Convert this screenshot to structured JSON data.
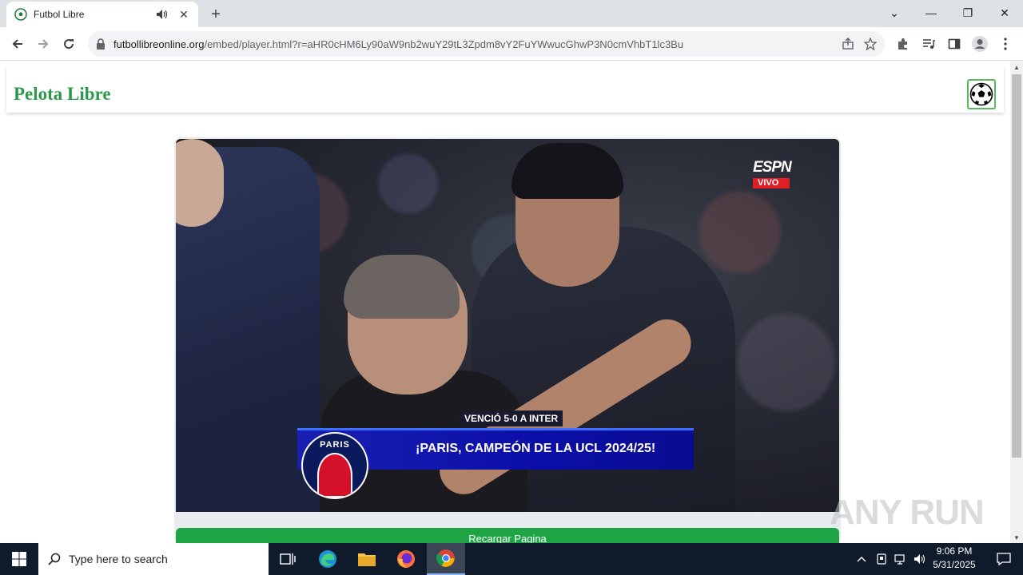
{
  "browser": {
    "tab": {
      "title": "Futbol Libre",
      "close_glyph": "✕"
    },
    "newtab_glyph": "+",
    "window_controls": {
      "tab_search_glyph": "⌄",
      "minimize_glyph": "—",
      "restore_glyph": "❐",
      "close_glyph": "✕"
    },
    "url": {
      "host": "futbollibreonline.org",
      "path": "/embed/player.html?r=aHR0cHM6Ly90aW9nb2wuY29tL3Zpdm8vY2FuYWwucGhwP3N0cmVhbT1lc3Bu"
    }
  },
  "site": {
    "brand": "Pelota Libre",
    "video": {
      "channel": {
        "logo": "ESPN",
        "live_label": "VIVO"
      },
      "lower_third": {
        "subhead": "VENCIÓ 5-0 A INTER",
        "badge_text": "PARIS",
        "headline": "¡PARIS, CAMPEÓN DE LA UCL 2024/25!"
      }
    },
    "reload_label": "Recargar Pagina"
  },
  "watermark": "ANY RUN",
  "taskbar": {
    "search_placeholder": "Type here to search",
    "clock": {
      "time": "9:06 PM",
      "date": "5/31/2025"
    }
  },
  "colors": {
    "brand_green": "#2a9a4a",
    "reload_green": "#1ea345",
    "espn_red": "#e01e26",
    "lower_third_blue": "#0b0fa8"
  }
}
